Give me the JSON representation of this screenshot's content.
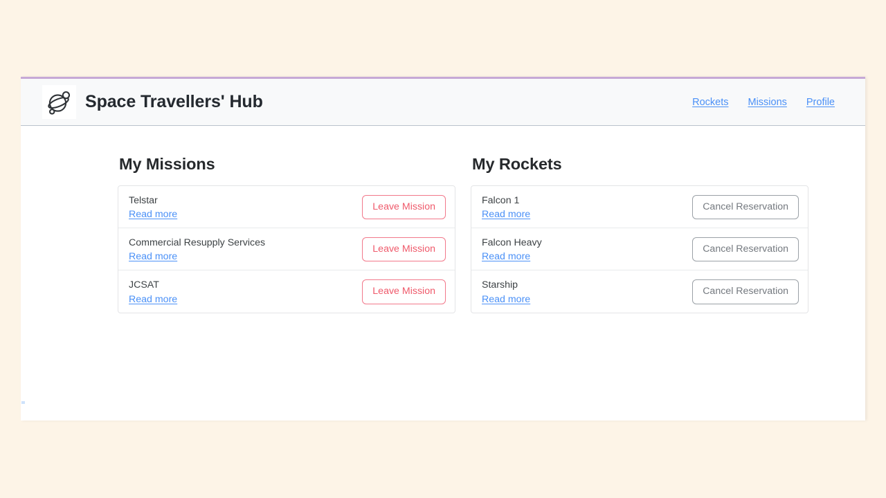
{
  "page": {
    "background_color": "#fdf4e7",
    "accent_top_border_color": "#c6a8d6"
  },
  "header": {
    "logo_icon": "planet-ring-icon",
    "title": "Space Travellers' Hub",
    "background_color": "#f8f9fa",
    "nav": [
      {
        "label": "Rockets",
        "name": "nav-link-rockets"
      },
      {
        "label": "Missions",
        "name": "nav-link-missions"
      },
      {
        "label": "Profile",
        "name": "nav-link-profile"
      }
    ],
    "link_color": "#4a90f7"
  },
  "main": {
    "missions": {
      "title": "My Missions",
      "read_more_label": "Read more",
      "action_label": "Leave Mission",
      "action_color": "#ef5a6b",
      "items": [
        {
          "name": "Telstar"
        },
        {
          "name": "Commercial Resupply Services"
        },
        {
          "name": "JCSAT"
        }
      ]
    },
    "rockets": {
      "title": "My Rockets",
      "read_more_label": "Read more",
      "action_label": "Cancel Reservation",
      "action_color": "#74797f",
      "items": [
        {
          "name": "Falcon 1"
        },
        {
          "name": "Falcon Heavy"
        },
        {
          "name": "Starship"
        }
      ]
    }
  }
}
